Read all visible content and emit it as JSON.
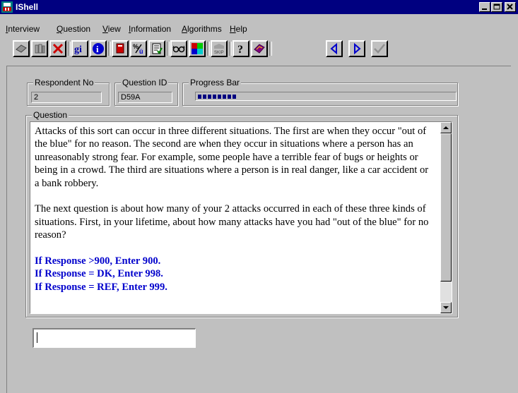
{
  "window": {
    "title": "IShell",
    "controls": [
      "minimize",
      "maximize",
      "close"
    ]
  },
  "menu": [
    {
      "label": "Interview",
      "accel": "I",
      "rest": "nterview"
    },
    {
      "label": "Question",
      "accel": "Q",
      "rest": "uestion"
    },
    {
      "label": "View",
      "accel": "V",
      "rest": "iew"
    },
    {
      "label": "Information",
      "accel": "I",
      "rest": "nformation"
    },
    {
      "label": "Algorithms",
      "accel": "A",
      "rest": "lgorithms"
    },
    {
      "label": "Help",
      "accel": "H",
      "rest": "elp"
    }
  ],
  "toolbar": {
    "gi_label": "gi",
    "info_label": "i",
    "skip_label": "SKIP",
    "help_label": "?",
    "icons": [
      "book-icon",
      "library-icon",
      "delete-x-icon",
      "gi-icon",
      "info-icon",
      "red-book-icon",
      "fraction-icon",
      "checklist-icon",
      "glasses-icon",
      "color-grid-icon",
      "skip-icon",
      "help-icon",
      "purple-book-icon",
      "prev-icon",
      "next-icon",
      "check-icon"
    ]
  },
  "fields": {
    "respondent_label": "Respondent No",
    "respondent_value": "2",
    "question_id_label": "Question ID",
    "question_id_value": "D59A",
    "progress_label": "Progress Bar",
    "progress_fraction": 0.17
  },
  "question": {
    "label": "Question",
    "para1": "Attacks of this sort can occur in three different situations. The first are when they occur \"out of the blue\" for no reason. The second are when they occur in situations where a person has an unreasonably strong fear. For example, some people have a terrible fear of bugs or heights or being in a crowd. The third are situations where a person is in real danger, like a car accident or a bank robbery.",
    "para2": "The next question is about how many of your 2 attacks occurred in each of these three kinds of situations. First, in your lifetime, about how many attacks have you had \"out of the blue\" for no reason?",
    "instr1": "If Response >900, Enter 900.",
    "instr2": "If Response = DK, Enter 998.",
    "instr3": "If Response = REF, Enter 999."
  },
  "answer": {
    "value": ""
  },
  "colors": {
    "title_bar": "#000080",
    "instruction_text": "#0000cc",
    "progress": "#000080"
  }
}
